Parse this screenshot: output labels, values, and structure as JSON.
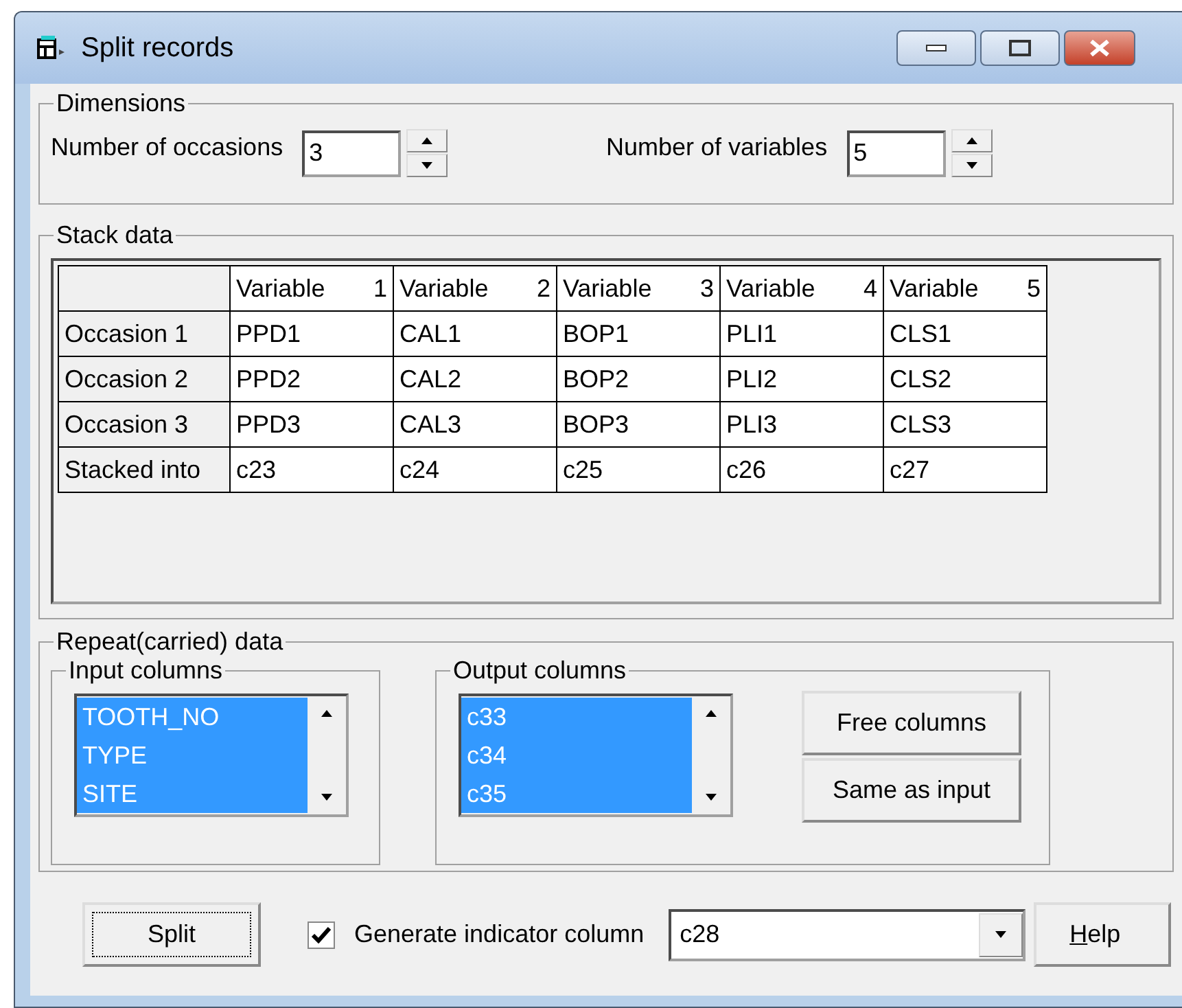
{
  "window": {
    "title": "Split records"
  },
  "dimensions": {
    "legend": "Dimensions",
    "fields": [
      {
        "label": "Number of occasions",
        "value": "3"
      },
      {
        "label": "Number of variables",
        "value": "5"
      }
    ]
  },
  "stack_data": {
    "legend": "Stack data",
    "columns": [
      {
        "label": "Variable",
        "number": "1"
      },
      {
        "label": "Variable",
        "number": "2"
      },
      {
        "label": "Variable",
        "number": "3"
      },
      {
        "label": "Variable",
        "number": "4"
      },
      {
        "label": "Variable",
        "number": "5"
      }
    ],
    "rows": [
      {
        "header": "Occasion 1",
        "cells": [
          "PPD1",
          "CAL1",
          "BOP1",
          "PLI1",
          "CLS1"
        ]
      },
      {
        "header": "Occasion 2",
        "cells": [
          "PPD2",
          "CAL2",
          "BOP2",
          "PLI2",
          "CLS2"
        ]
      },
      {
        "header": "Occasion 3",
        "cells": [
          "PPD3",
          "CAL3",
          "BOP3",
          "PLI3",
          "CLS3"
        ]
      },
      {
        "header": "Stacked into",
        "cells": [
          "c23",
          "c24",
          "c25",
          "c26",
          "c27"
        ]
      }
    ]
  },
  "repeat_data": {
    "legend": "Repeat(carried) data",
    "input_columns": {
      "legend": "Input columns",
      "items": [
        {
          "label": "TOOTH_NO",
          "selected": true
        },
        {
          "label": "TYPE",
          "selected": true
        },
        {
          "label": "SITE",
          "selected": true
        }
      ]
    },
    "output_columns": {
      "legend": "Output columns",
      "items": [
        {
          "label": "c33",
          "selected": true
        },
        {
          "label": "c34",
          "selected": true
        },
        {
          "label": "c35",
          "selected": true
        }
      ]
    },
    "buttons": [
      "Free columns",
      "Same as input"
    ]
  },
  "footer": {
    "split_button": {
      "label": "Split",
      "focused": true
    },
    "indicator": {
      "label": "Generate indicator column",
      "checked": true
    },
    "indicator_column": "c28",
    "help_button": {
      "label": "Help",
      "mnemonic_underlined": true
    }
  }
}
